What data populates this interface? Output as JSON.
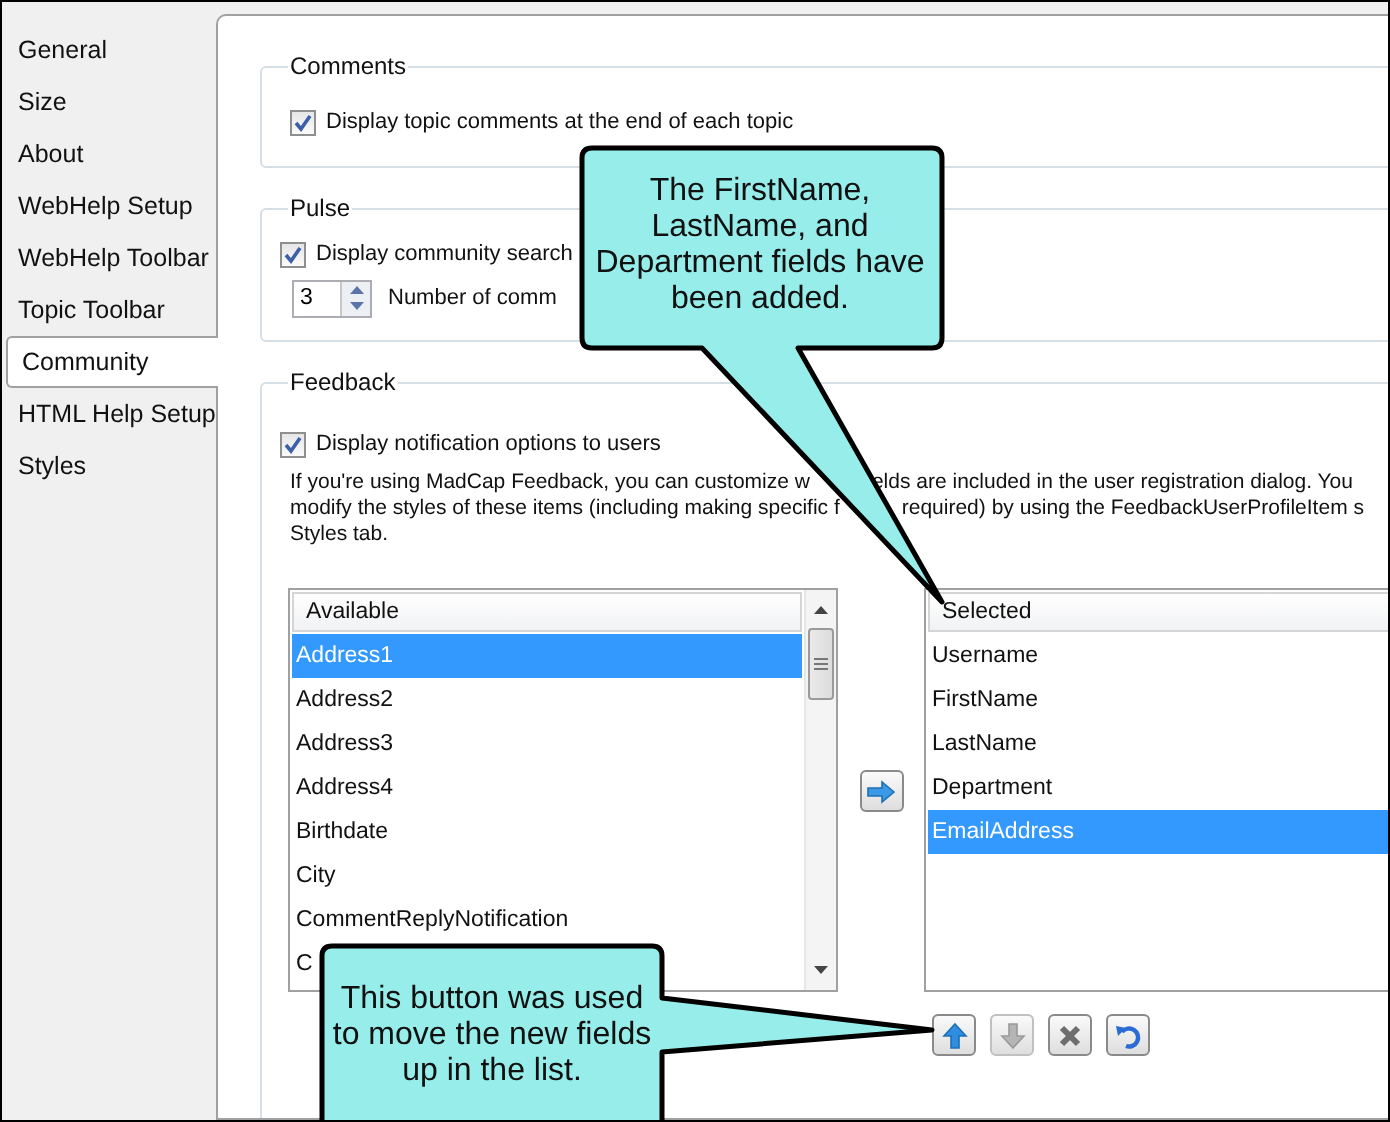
{
  "sidebar": {
    "items": [
      {
        "label": "General",
        "selected": false
      },
      {
        "label": "Size",
        "selected": false
      },
      {
        "label": "About",
        "selected": false
      },
      {
        "label": "WebHelp Setup",
        "selected": false
      },
      {
        "label": "WebHelp Toolbar",
        "selected": false
      },
      {
        "label": "Topic Toolbar",
        "selected": false
      },
      {
        "label": "Community",
        "selected": true
      },
      {
        "label": "HTML Help Setup",
        "selected": false
      },
      {
        "label": "Styles",
        "selected": false
      }
    ]
  },
  "comments": {
    "title": "Comments",
    "option": {
      "label": "Display topic comments at the end of each topic",
      "checked": true
    }
  },
  "pulse": {
    "title": "Pulse",
    "option": {
      "label": "Display community search",
      "checked": true
    },
    "count": {
      "value": "3",
      "label": "Number of comm"
    }
  },
  "feedback": {
    "title": "Feedback",
    "option": {
      "label": "Display notification options to users",
      "checked": true
    },
    "description_lines": [
      [
        "If you're using MadCap Feedback, you can customize w",
        "elds are included in the user registration dialog. You"
      ],
      [
        "modify the styles of these items (including making specific f",
        "required) by using the FeedbackUserProfileItem s"
      ],
      [
        "Styles tab."
      ]
    ],
    "available": {
      "header": "Available",
      "items": [
        {
          "label": "Address1",
          "selected": true
        },
        {
          "label": "Address2",
          "selected": false
        },
        {
          "label": "Address3",
          "selected": false
        },
        {
          "label": "Address4",
          "selected": false
        },
        {
          "label": "Birthdate",
          "selected": false
        },
        {
          "label": "City",
          "selected": false
        },
        {
          "label": "CommentReplyNotification",
          "selected": false
        },
        {
          "label": "C",
          "selected": false
        }
      ]
    },
    "selected_fields": {
      "header": "Selected",
      "items": [
        {
          "label": "Username",
          "selected": false
        },
        {
          "label": "FirstName",
          "selected": false
        },
        {
          "label": "LastName",
          "selected": false
        },
        {
          "label": "Department",
          "selected": false
        },
        {
          "label": "EmailAddress",
          "selected": true
        }
      ]
    },
    "order_buttons": [
      {
        "kind": "up",
        "disabled": false
      },
      {
        "kind": "down",
        "disabled": true
      },
      {
        "kind": "remove",
        "disabled": false
      },
      {
        "kind": "undo",
        "disabled": false
      }
    ]
  },
  "callouts": [
    {
      "text": "The FirstName, LastName, and Department fields have been added."
    },
    {
      "text": "This button was used to move the new fields up in the list."
    }
  ]
}
